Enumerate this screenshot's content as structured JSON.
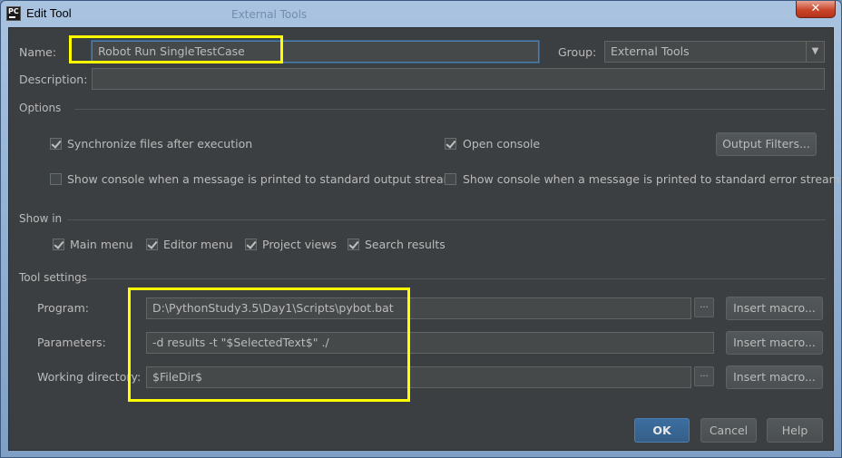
{
  "window": {
    "title": "Edit Tool",
    "app_icon_text": "PC",
    "close_symbol": "✕",
    "background_title": "External Tools"
  },
  "name": {
    "label": "Name:",
    "value": "Robot Run SingleTestCase"
  },
  "group": {
    "label": "Group:",
    "value": "External Tools",
    "arrow": "▼"
  },
  "description": {
    "label": "Description:",
    "value": ""
  },
  "options": {
    "title": "Options",
    "sync_files": {
      "label": "Synchronize files after execution",
      "checked": true
    },
    "open_console": {
      "label": "Open console",
      "checked": true
    },
    "output_filters_button": "Output Filters...",
    "show_console_stdout": {
      "label": "Show console when a message is printed to standard output stream",
      "checked": false
    },
    "show_console_stderr": {
      "label": "Show console when a message is printed to standard error stream",
      "checked": false
    }
  },
  "show_in": {
    "title": "Show in",
    "items": [
      {
        "label": "Main menu",
        "checked": true
      },
      {
        "label": "Editor menu",
        "checked": true
      },
      {
        "label": "Project views",
        "checked": true
      },
      {
        "label": "Search results",
        "checked": true
      }
    ]
  },
  "tool_settings": {
    "title": "Tool settings",
    "program": {
      "label": "Program:",
      "value": "D:\\PythonStudy3.5\\Day1\\Scripts\\pybot.bat"
    },
    "parameters": {
      "label": "Parameters:",
      "value": "-d results -t \"$SelectedText$\" ./"
    },
    "working_directory": {
      "label": "Working directory:",
      "value": "$FileDir$"
    },
    "browse_symbol": "...",
    "insert_macro_label": "Insert macro..."
  },
  "footer": {
    "ok": "OK",
    "cancel": "Cancel",
    "help": "Help"
  },
  "colors": {
    "dialog_bg": "#3c3f41",
    "field_bg": "#45494a",
    "text": "#bbbbbb",
    "highlight": "#ffff00",
    "ok_button": "#365f88"
  },
  "icons": [
    "app-logo-icon",
    "close-icon",
    "chevron-down-icon",
    "checkbox-check-icon",
    "ellipsis-icon"
  ]
}
